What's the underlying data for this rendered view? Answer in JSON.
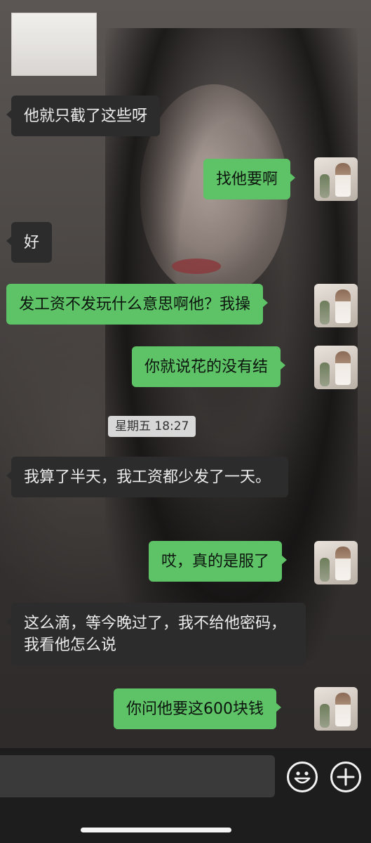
{
  "messages": [
    {
      "side": "left",
      "text": "他就只截了这些呀"
    },
    {
      "side": "right",
      "text": "找他要啊"
    },
    {
      "side": "left",
      "text": "好"
    },
    {
      "side": "right",
      "text": "发工资不发玩什么意思啊他？我操"
    },
    {
      "side": "right",
      "text": "你就说花的没有结"
    },
    {
      "side": "left",
      "text": "我算了半天，我工资都少发了一天。"
    },
    {
      "side": "right",
      "text": "哎，真的是服了"
    },
    {
      "side": "left",
      "text": "这么滴，等今晚过了，我不给他密码，我看他怎么说"
    },
    {
      "side": "right",
      "text": "你问他要这600块钱"
    }
  ],
  "timestamp": "星期五 18:27",
  "input": {
    "placeholder": ""
  },
  "icons": {
    "emoji": "smile-icon",
    "more": "plus-icon"
  },
  "colors": {
    "sent_bubble": "#5ec267",
    "received_bubble": "#2c2c2c"
  }
}
